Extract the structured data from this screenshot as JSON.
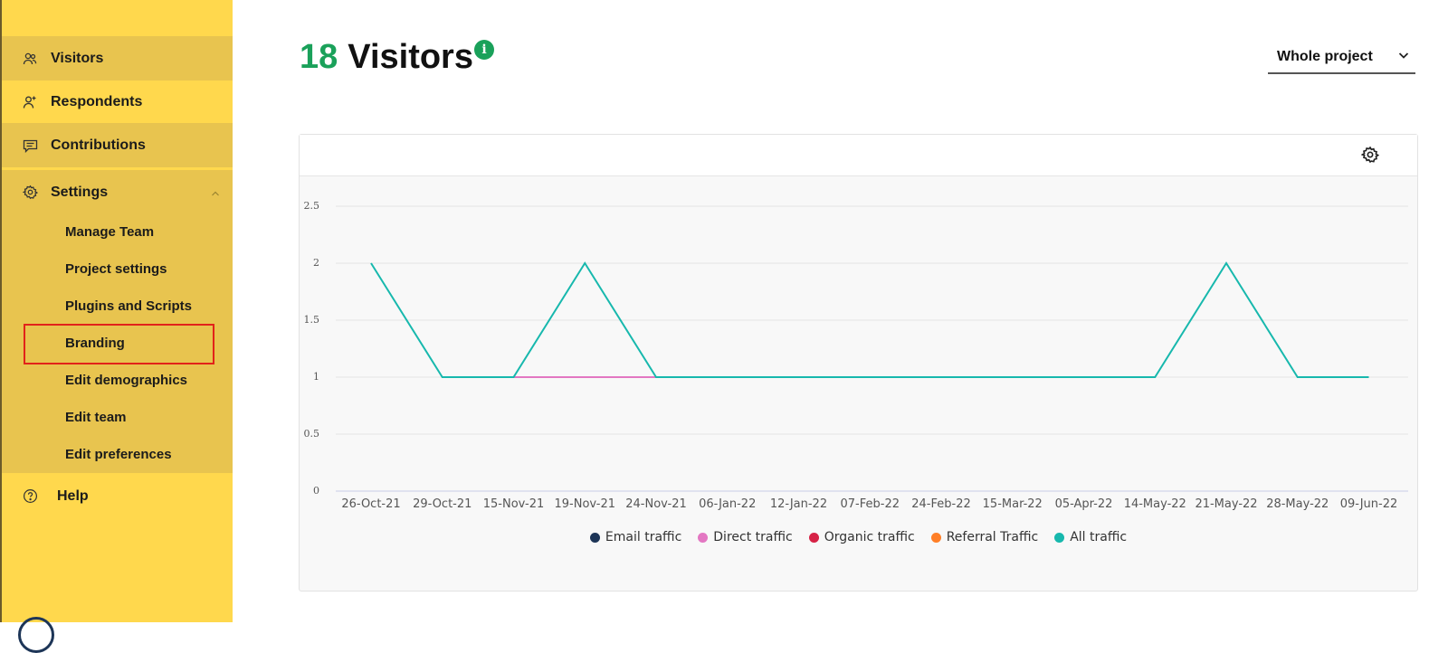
{
  "sidebar": {
    "items": [
      {
        "label": "Visitors",
        "icon": "visitors-icon"
      },
      {
        "label": "Respondents",
        "icon": "add-user-icon"
      },
      {
        "label": "Contributions",
        "icon": "comments-icon"
      },
      {
        "label": "Settings",
        "icon": "gear-icon"
      },
      {
        "label": "Help",
        "icon": "help-icon"
      }
    ],
    "settings_submenu": [
      "Manage Team",
      "Project settings",
      "Plugins and Scripts",
      "Branding",
      "Edit demographics",
      "Edit team",
      "Edit preferences"
    ],
    "highlighted_item": "Branding"
  },
  "header": {
    "count": "18",
    "title": "Visitors",
    "info_icon": "info-icon"
  },
  "scope_select": {
    "selected": "Whole project"
  },
  "colors": {
    "sidebar_bg": "#ffd84d",
    "sidebar_active": "#e8c44f",
    "accent_green": "#1aa15a",
    "highlight_red": "#e2231a"
  },
  "chart_data": {
    "type": "line",
    "categories": [
      "26-Oct-21",
      "29-Oct-21",
      "15-Nov-21",
      "19-Nov-21",
      "24-Nov-21",
      "06-Jan-22",
      "12-Jan-22",
      "07-Feb-22",
      "24-Feb-22",
      "15-Mar-22",
      "05-Apr-22",
      "14-May-22",
      "21-May-22",
      "28-May-22",
      "09-Jun-22"
    ],
    "yticks": [
      "0",
      "0.5",
      "1",
      "1.5",
      "2",
      "2.5"
    ],
    "ylim": [
      0,
      2.5
    ],
    "grid": true,
    "legend_position": "bottom",
    "series": [
      {
        "name": "Email traffic",
        "color": "#1d3557",
        "values": [
          null,
          null,
          null,
          null,
          null,
          null,
          null,
          null,
          null,
          null,
          null,
          null,
          null,
          null,
          null
        ]
      },
      {
        "name": "Direct traffic",
        "color": "#e377c2",
        "values": [
          null,
          null,
          1,
          1,
          1,
          null,
          null,
          null,
          null,
          null,
          null,
          null,
          null,
          null,
          null
        ]
      },
      {
        "name": "Organic traffic",
        "color": "#d62246",
        "values": [
          null,
          null,
          null,
          null,
          null,
          null,
          null,
          null,
          null,
          null,
          null,
          null,
          null,
          null,
          null
        ]
      },
      {
        "name": "Referral Traffic",
        "color": "#ff7f27",
        "values": [
          null,
          null,
          null,
          null,
          null,
          null,
          null,
          null,
          null,
          null,
          null,
          null,
          null,
          null,
          null
        ]
      },
      {
        "name": "All traffic",
        "color": "#17b8ad",
        "values": [
          2,
          1,
          1,
          2,
          1,
          1,
          1,
          1,
          1,
          1,
          1,
          1,
          2,
          1,
          1
        ]
      }
    ]
  }
}
